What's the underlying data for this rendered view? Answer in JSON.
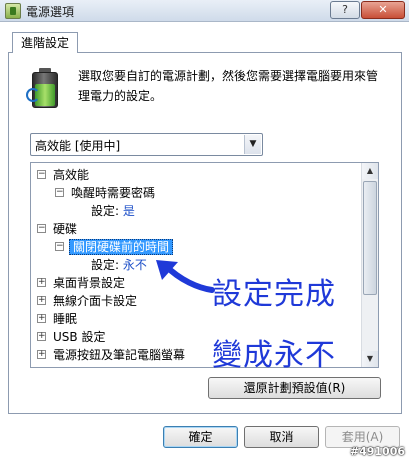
{
  "window": {
    "title": "電源選項",
    "help_label": "?",
    "close_label": "✕"
  },
  "tab": {
    "label": "進階設定"
  },
  "description": "選取您要自訂的電源計劃，然後您需要選擇電腦要用來管理電力的設定。",
  "plan_select": {
    "value": "高效能 [使用中]"
  },
  "tree": {
    "items": [
      {
        "label": "高效能",
        "expander": "−"
      },
      {
        "label": "喚醒時需要密碼",
        "expander": "−"
      },
      {
        "setting_label": "設定:",
        "setting_value": "是"
      },
      {
        "label": "硬碟",
        "expander": "−"
      },
      {
        "label": "關閉硬碟前的時間",
        "expander": "−"
      },
      {
        "setting_label": "設定:",
        "setting_value": "永不"
      },
      {
        "label": "桌面背景設定",
        "expander": "+"
      },
      {
        "label": "無線介面卡設定",
        "expander": "+"
      },
      {
        "label": "睡眠",
        "expander": "+"
      },
      {
        "label": "USB 設定",
        "expander": "+"
      },
      {
        "label": "電源按鈕及筆記電腦螢幕",
        "expander": "+"
      }
    ]
  },
  "annotation": {
    "line1": "設定完成",
    "line2": "變成永不"
  },
  "buttons": {
    "restore": "還原計劃預設值(R)",
    "ok": "確定",
    "cancel": "取消",
    "apply": "套用(A)"
  },
  "watermark": "#491006",
  "colors": {
    "selection": "#3399ff",
    "annotation": "#1f39d8",
    "setting_value": "#1e50c8"
  }
}
